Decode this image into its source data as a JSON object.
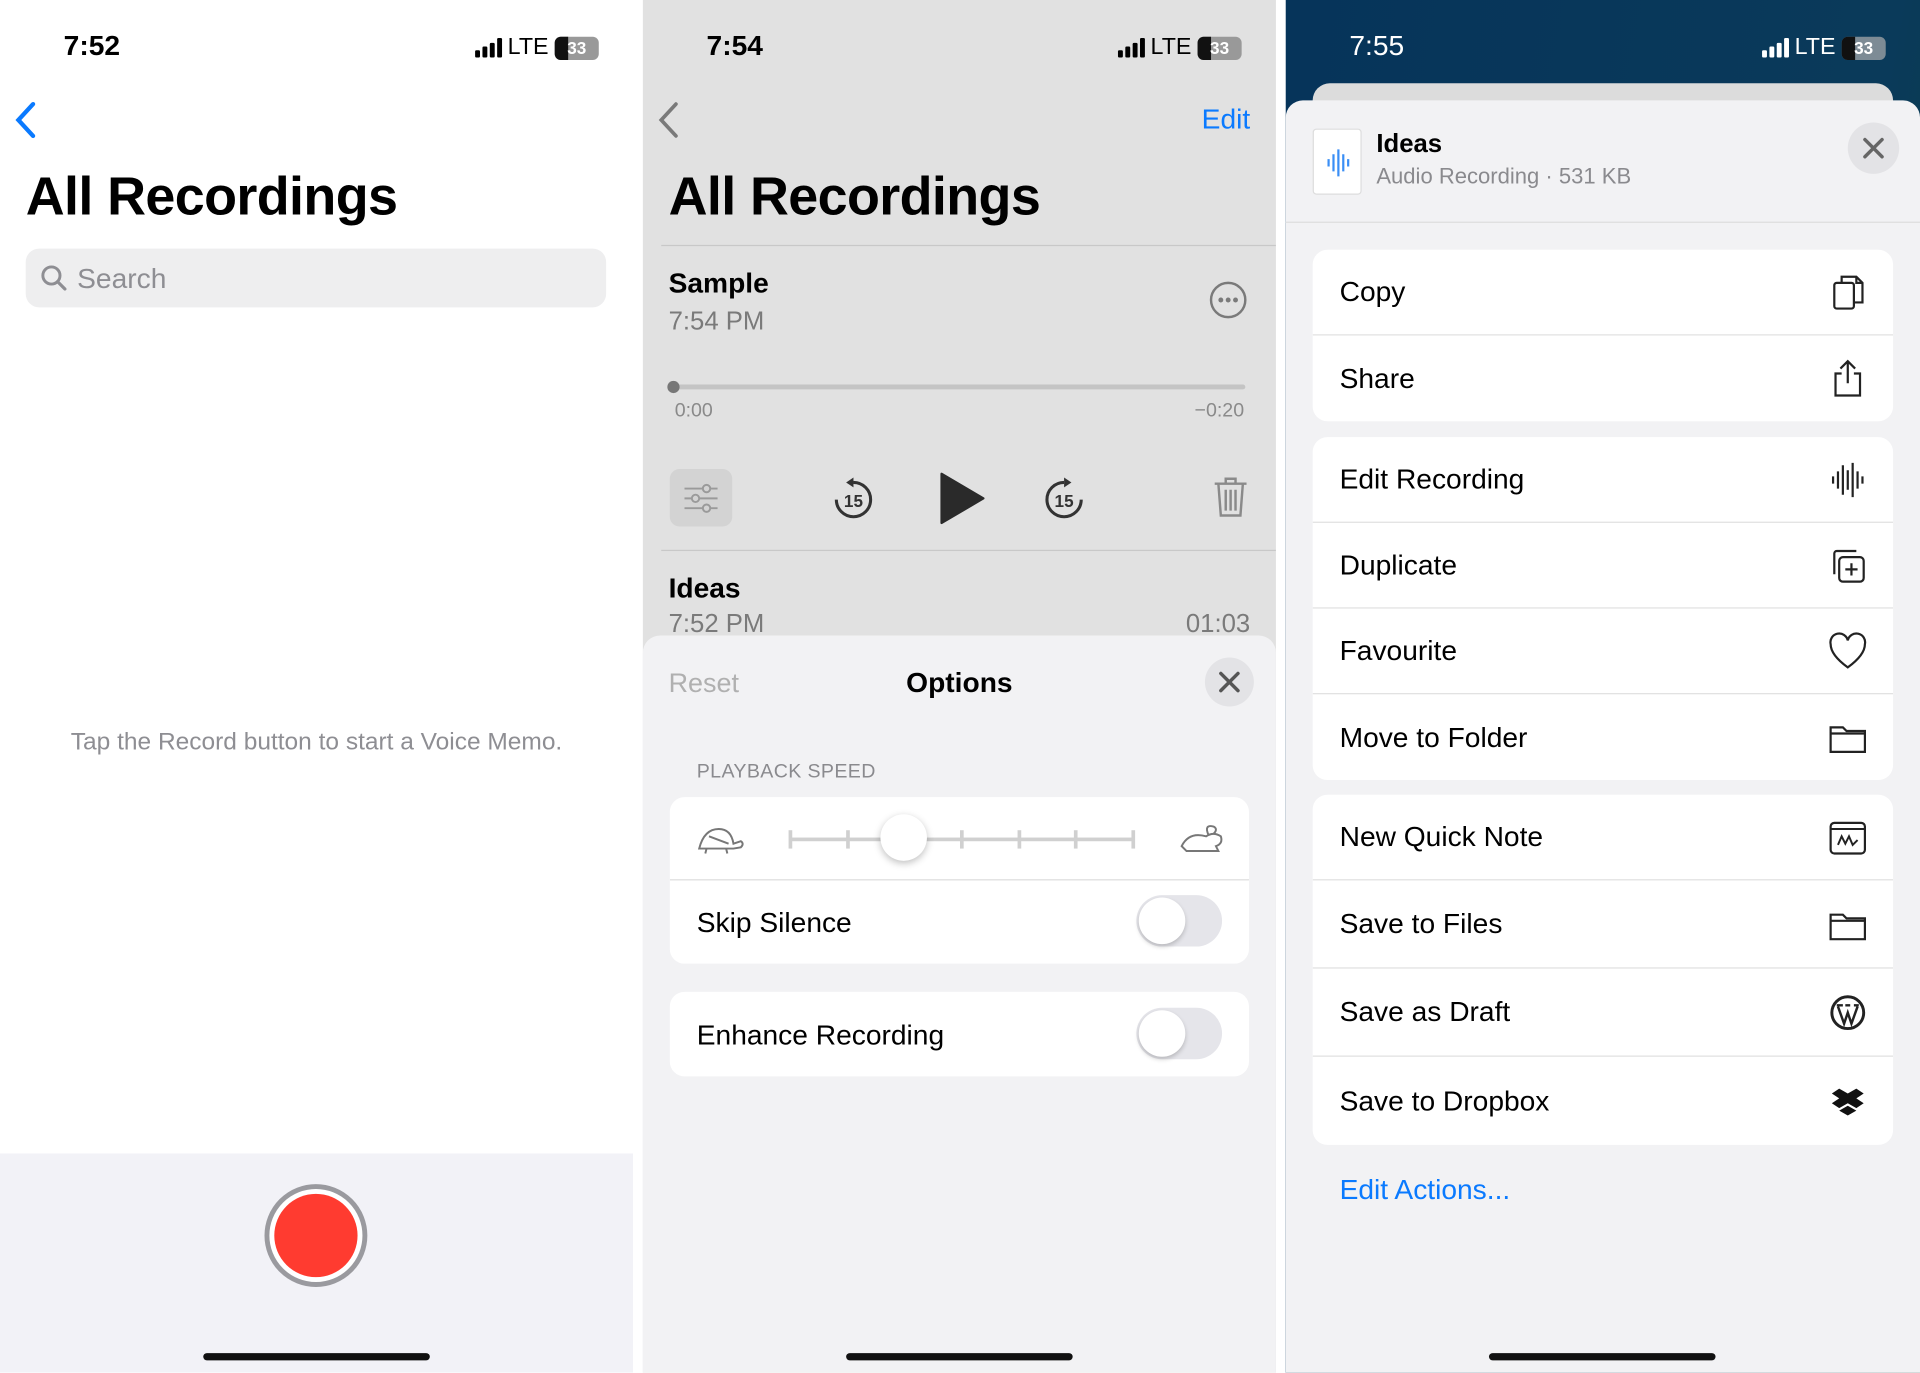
{
  "panel1": {
    "time": "7:52",
    "network": "LTE",
    "battery": "33",
    "title": "All Recordings",
    "search_placeholder": "Search",
    "empty_message": "Tap the Record button to start a Voice Memo.",
    "record_color": "#ff3b30"
  },
  "panel2": {
    "time": "7:54",
    "network": "LTE",
    "battery": "33",
    "edit_label": "Edit",
    "title": "All Recordings",
    "recordings": [
      {
        "name": "Sample",
        "time": "7:54 PM",
        "elapsed": "0:00",
        "remaining": "−0:20"
      },
      {
        "name": "Ideas",
        "time": "7:52 PM",
        "duration": "01:03"
      }
    ],
    "options": {
      "reset_label": "Reset",
      "title": "Options",
      "section_label": "PLAYBACK SPEED",
      "playback_speed_step": 2,
      "playback_speed_steps": 7,
      "skip_silence_label": "Skip Silence",
      "skip_silence_on": false,
      "enhance_label": "Enhance Recording",
      "enhance_on": false
    }
  },
  "panel3": {
    "time": "7:55",
    "network": "LTE",
    "battery": "33",
    "file_name": "Ideas",
    "file_meta": "Audio Recording · 531 KB",
    "groups": [
      [
        {
          "label": "Copy",
          "icon": "copy-icon"
        },
        {
          "label": "Share",
          "icon": "share-icon"
        }
      ],
      [
        {
          "label": "Edit Recording",
          "icon": "waveform-icon"
        },
        {
          "label": "Duplicate",
          "icon": "duplicate-icon"
        },
        {
          "label": "Favourite",
          "icon": "heart-icon"
        },
        {
          "label": "Move to Folder",
          "icon": "folder-icon"
        }
      ],
      [
        {
          "label": "New Quick Note",
          "icon": "quick-note-icon"
        },
        {
          "label": "Save to Files",
          "icon": "folder-icon"
        },
        {
          "label": "Save as Draft",
          "icon": "wordpress-icon"
        },
        {
          "label": "Save to Dropbox",
          "icon": "dropbox-icon"
        }
      ]
    ],
    "edit_actions_label": "Edit Actions...",
    "accent": "#0a7aff"
  }
}
